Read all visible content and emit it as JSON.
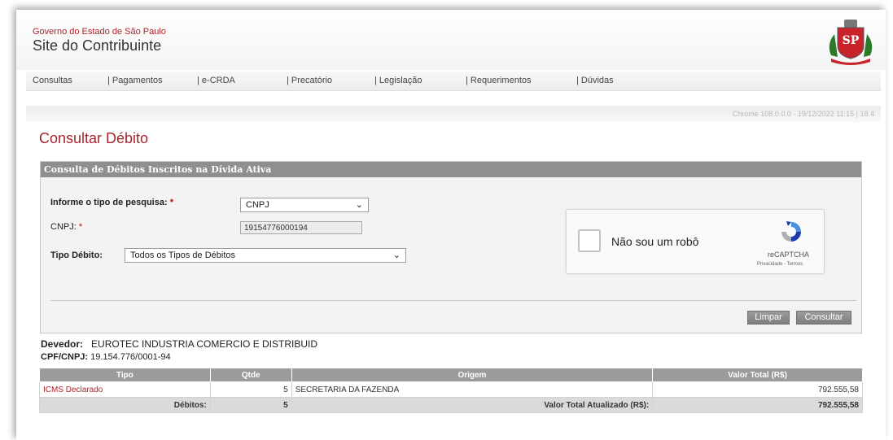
{
  "header": {
    "government": "Governo do Estado de São Paulo",
    "site_title": "Site do Contribuinte",
    "logo_text": "SP"
  },
  "nav": {
    "items": [
      "Consultas",
      "| Pagamentos",
      "| e-CRDA",
      "| Precatório",
      "| Legislação",
      "| Requerimentos",
      "| Dúvidas"
    ]
  },
  "browser_info": "Chrome 108.0.0.0 · 19/12/2022 11:15 | 18.4",
  "page_title": "Consultar Débito",
  "form": {
    "panel_title": "Consulta de Débitos Inscritos na Dívida Ativa",
    "search_type_label": "Informe o tipo de pesquisa:",
    "search_type_value": "CNPJ",
    "cnpj_label": "CNPJ:",
    "cnpj_value": "19154776000194",
    "debit_type_label": "Tipo Débito:",
    "debit_type_value": "Todos os Tipos de Débitos",
    "required_mark": "*",
    "clear_button": "Limpar",
    "submit_button": "Consultar"
  },
  "captcha": {
    "label": "Não sou um robô",
    "brand": "reCAPTCHA",
    "links": "Privacidade - Termos"
  },
  "result": {
    "debtor_label": "Devedor:",
    "debtor_name": "EUROTEC INDUSTRIA COMERCIO E DISTRIBUID",
    "cpf_label": "CPF/CNPJ:",
    "cpf_value": "19.154.776/0001-94",
    "columns": [
      "Tipo",
      "Qtde",
      "Origem",
      "Valor Total (R$)"
    ],
    "rows": [
      {
        "tipo": "ICMS Declarado",
        "qtde": "5",
        "origem": "SECRETARIA DA FAZENDA",
        "valor": "792.555,58"
      }
    ],
    "totals": {
      "label": "Débitos:",
      "qtde": "5",
      "updated_label": "Valor Total Atualizado (R$):",
      "valor": "792.555,58"
    }
  },
  "colors": {
    "accent_red": "#a3262d",
    "header_gray": "#8f8f8f"
  }
}
